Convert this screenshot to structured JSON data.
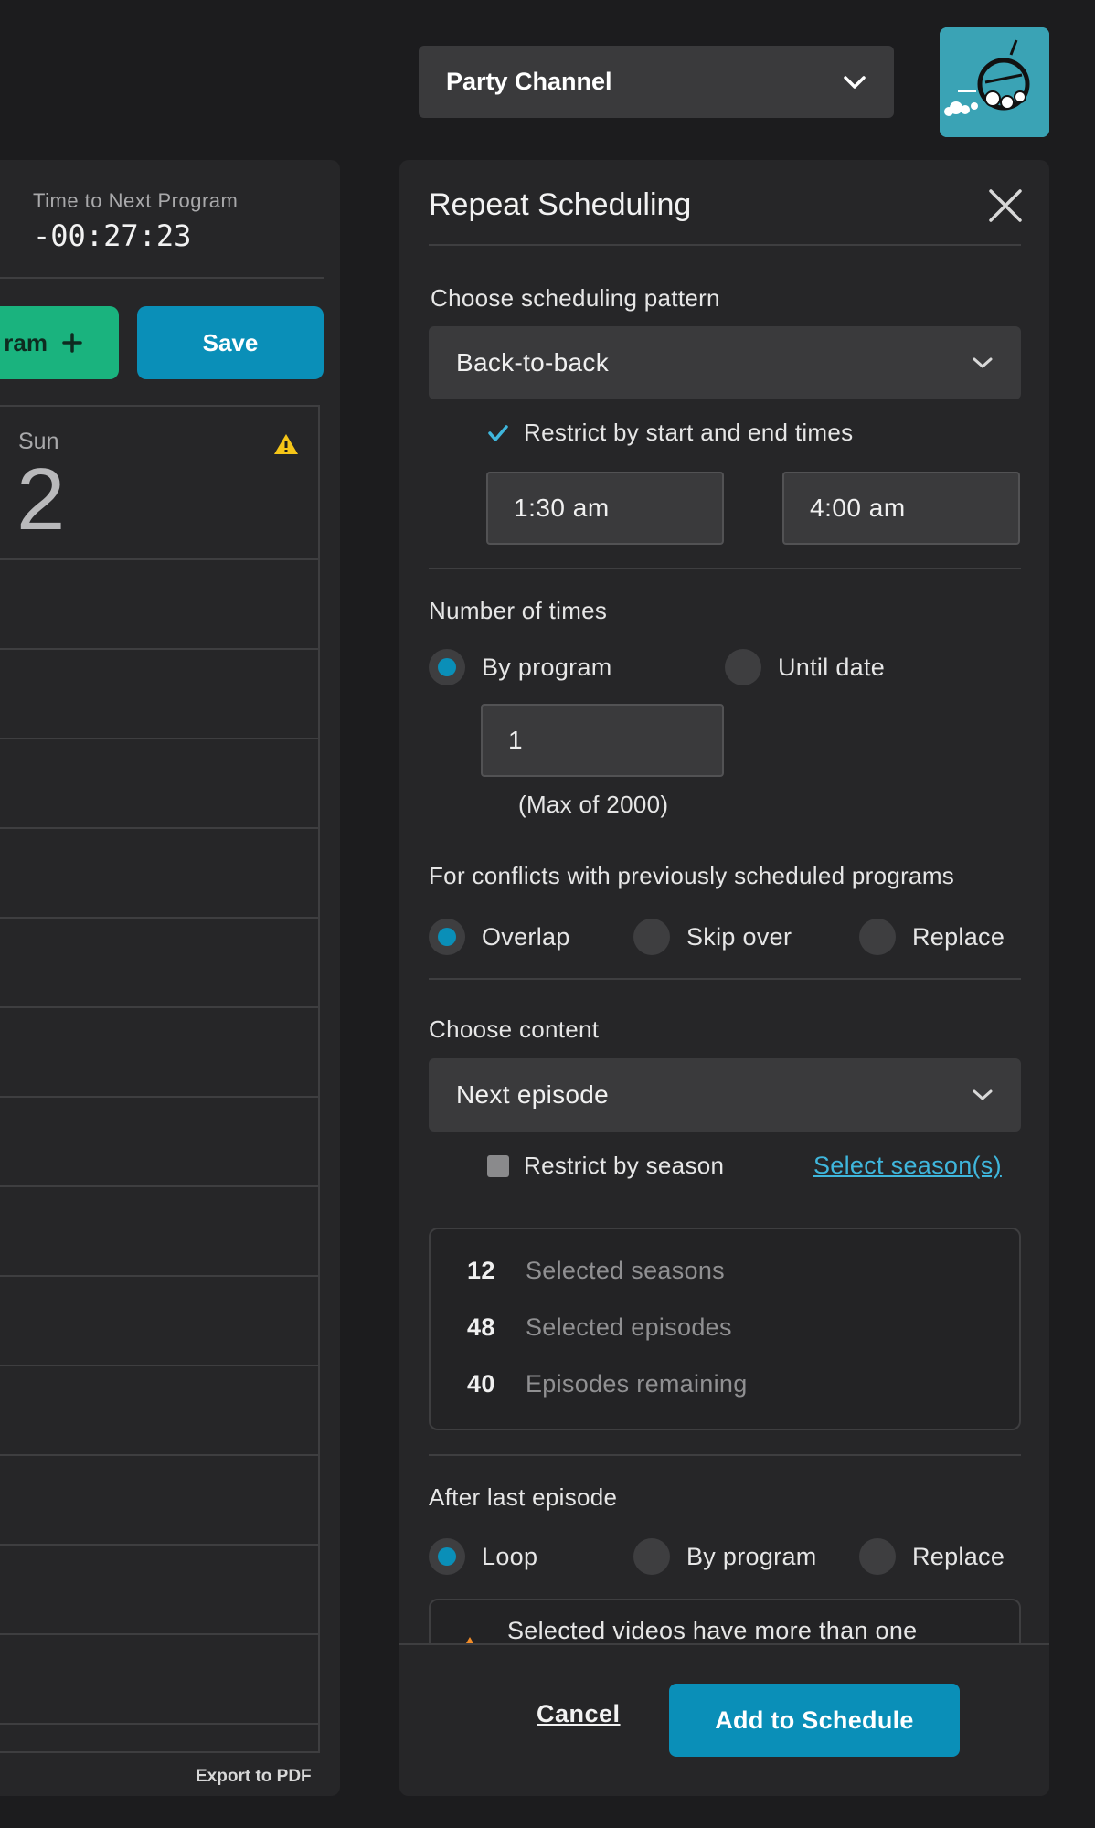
{
  "header": {
    "channel": "Party Channel"
  },
  "scheduler": {
    "next_label": "Time to Next Program",
    "next_time": "-00:27:23",
    "add_program_label": "ram",
    "save_label": "Save",
    "day": {
      "name": "Sun",
      "number": "2"
    },
    "export_label": "Export to PDF"
  },
  "repeat": {
    "title": "Repeat Scheduling",
    "pattern_label": "Choose scheduling pattern",
    "pattern_value": "Back-to-back",
    "restrict_times_label": "Restrict by start and end times",
    "restrict_times_checked": true,
    "start_time": "1:30 am",
    "end_time": "4:00 am",
    "number_label": "Number of times",
    "number_options": [
      "By program",
      "Until date"
    ],
    "number_selected": "By program",
    "count_value": "1",
    "count_hint": "(Max of 2000)",
    "conflicts_label": "For conflicts with previously scheduled programs",
    "conflict_options": [
      "Overlap",
      "Skip over",
      "Replace"
    ],
    "conflict_selected": "Overlap",
    "content_label": "Choose content",
    "content_value": "Next episode",
    "restrict_season_label": "Restrict by season",
    "restrict_season_checked": false,
    "select_seasons_link": "Select season(s)",
    "stats": [
      {
        "count": "12",
        "label": "Selected seasons"
      },
      {
        "count": "48",
        "label": "Selected episodes"
      },
      {
        "count": "40",
        "label": "Episodes remaining"
      }
    ],
    "after_label": "After last episode",
    "after_options": [
      "Loop",
      "By program",
      "Replace"
    ],
    "after_selected": "Loop",
    "warning_text": "Selected videos have more than one",
    "cancel_label": "Cancel",
    "add_label": "Add to Schedule"
  },
  "colors": {
    "accent_blue": "#0a8fb8",
    "accent_green": "#1ab37e",
    "link_blue": "#3fb6dc",
    "warning_yellow": "#f5c518",
    "warning_orange": "#f28c28"
  }
}
